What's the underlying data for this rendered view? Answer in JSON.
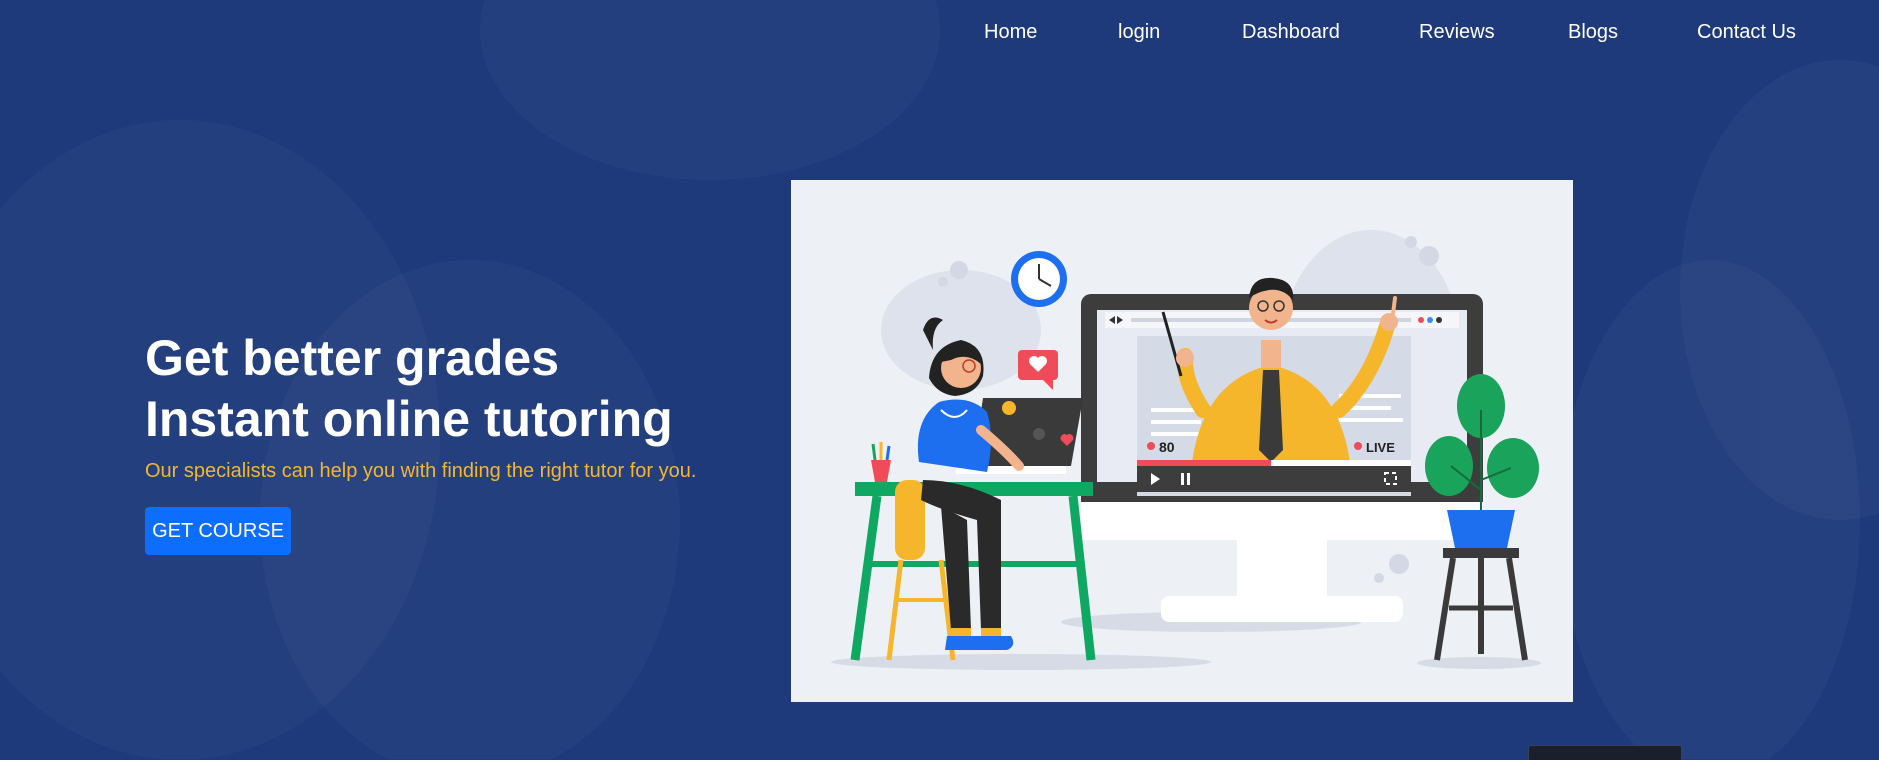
{
  "nav": {
    "items": [
      {
        "label": "Home"
      },
      {
        "label": "login"
      },
      {
        "label": "Dashboard"
      },
      {
        "label": "Reviews"
      },
      {
        "label": "Blogs"
      },
      {
        "label": "Contact Us"
      }
    ]
  },
  "hero": {
    "title_line1": "Get better grades",
    "title_line2": "Instant online tutoring",
    "subtitle": "Our specialists can help you with finding the right tutor for you.",
    "cta_label": "GET COURSE"
  },
  "illustration": {
    "viewer_count": "80",
    "live_label": "LIVE"
  },
  "colors": {
    "background": "#1e3a7b",
    "accent_yellow": "#f5b62b",
    "button_blue": "#0d6efd"
  }
}
